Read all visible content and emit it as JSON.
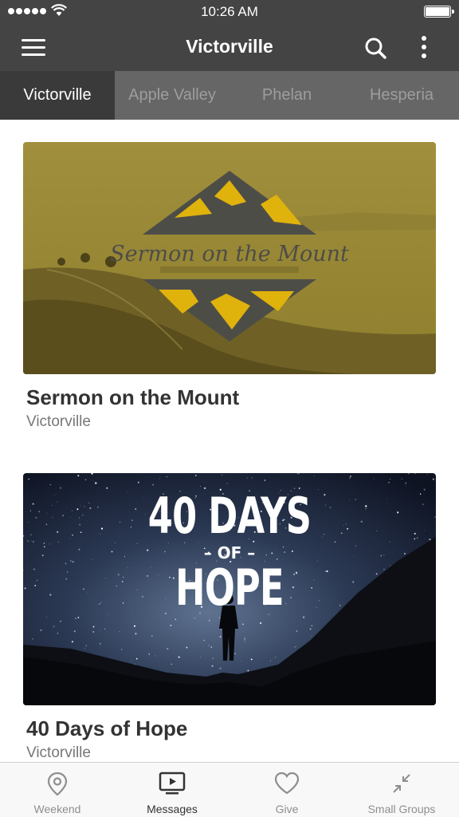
{
  "status_bar": {
    "time": "10:26 AM"
  },
  "nav": {
    "title": "Victorville"
  },
  "tabs": [
    {
      "label": "Victorville",
      "active": true
    },
    {
      "label": "Apple Valley",
      "active": false
    },
    {
      "label": "Phelan",
      "active": false
    },
    {
      "label": "Hesperia",
      "active": false
    }
  ],
  "series": [
    {
      "title": "Sermon on the Mount",
      "campus": "Victorville",
      "art": {
        "logo_text": "Sermon on the Mount",
        "tint": "#8a7a1f",
        "accent": "#e0b20c"
      }
    },
    {
      "title": "40 Days of Hope",
      "campus": "Victorville",
      "art": {
        "line1": "40 DAYS",
        "line2": "OF",
        "line3": "HOPE"
      }
    }
  ],
  "tab_bar": [
    {
      "label": "Weekend",
      "icon": "location-pin-icon",
      "active": false
    },
    {
      "label": "Messages",
      "icon": "tv-play-icon",
      "active": true
    },
    {
      "label": "Give",
      "icon": "heart-icon",
      "active": false
    },
    {
      "label": "Small Groups",
      "icon": "collapse-arrows-icon",
      "active": false
    }
  ]
}
